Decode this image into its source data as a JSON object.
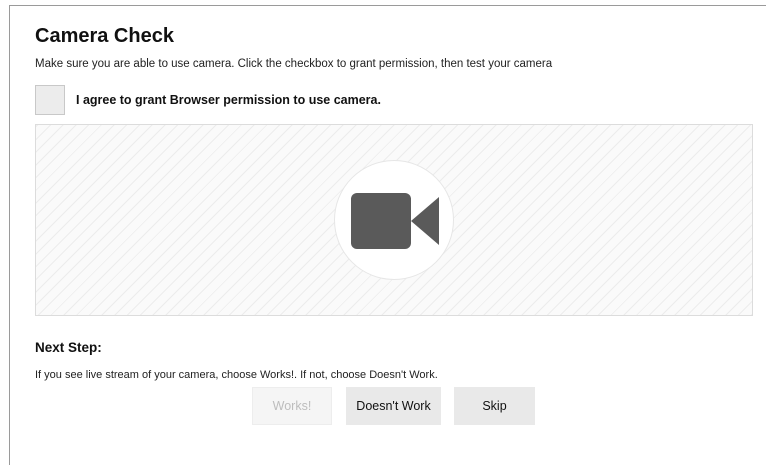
{
  "page": {
    "title": "Camera Check",
    "subtitle": "Make sure you are able to use camera. Click the checkbox to grant permission, then test your camera",
    "agree_label": "I agree to grant Browser permission to use camera.",
    "agree_checked": false,
    "camera_icon": "video-camera-icon",
    "next_step_title": "Next Step:",
    "instructions": "If you see live stream of your camera, choose Works!. If not, choose Doesn't Work."
  },
  "buttons": {
    "works": {
      "label": "Works!",
      "disabled": true
    },
    "doesnt_work": {
      "label": "Doesn't Work"
    },
    "skip": {
      "label": "Skip"
    }
  },
  "colors": {
    "icon": "#5a5a5a",
    "button_bg": "#e9e9e9",
    "disabled_text": "#bdbdbd"
  }
}
